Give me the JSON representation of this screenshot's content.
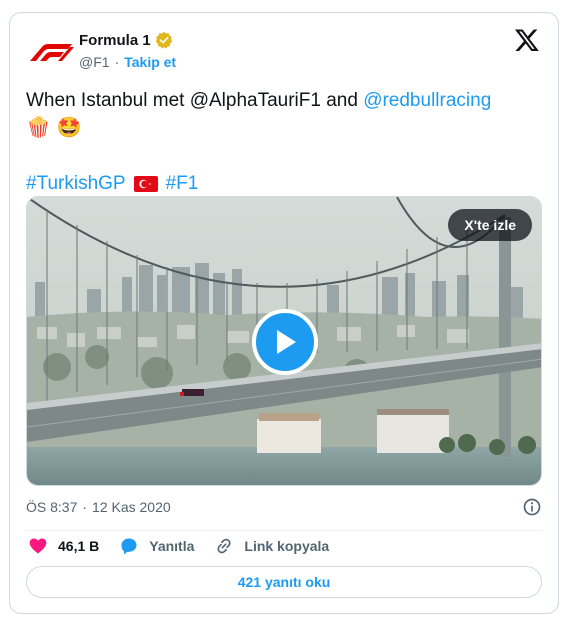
{
  "author": {
    "name": "Formula 1",
    "handle": "@F1",
    "separator": "·",
    "follow_label": "Takip et"
  },
  "tweet": {
    "text_prefix": "When Istanbul met @AlphaTauriF1 and ",
    "mention_link": "@redbullracing",
    "emoji_line": "🍿 🤩",
    "hashtag_1": "#TurkishGP",
    "hashtag_2": "#F1"
  },
  "media": {
    "watch_label": "X'te izle"
  },
  "meta": {
    "time": "ÖS 8:37",
    "separator": "·",
    "date": "12 Kas 2020"
  },
  "actions": {
    "like_count": "46,1 B",
    "reply_label": "Yanıtla",
    "copy_link_label": "Link kopyala"
  },
  "replies_button": "421 yanıtı oku",
  "colors": {
    "accent": "#1d9bf0",
    "text": "#0f1419",
    "muted": "#536471",
    "border": "#cfd9de",
    "like": "#f91880",
    "brand_red": "#e10600"
  },
  "icons": [
    "f1-logo",
    "verified-badge-icon",
    "x-logo-icon",
    "play-icon",
    "info-icon",
    "heart-icon",
    "reply-bubble-icon",
    "link-icon",
    "turkey-flag-icon"
  ]
}
